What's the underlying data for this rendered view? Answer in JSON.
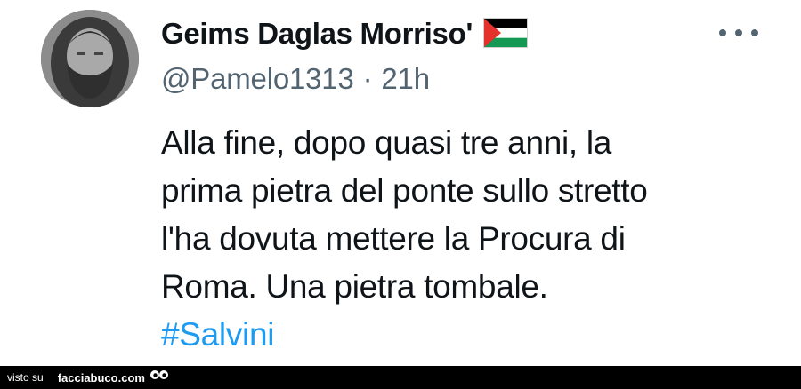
{
  "tweet": {
    "display_name": "Geims Daglas Morriso'",
    "flag_icon": "palestine-flag-icon",
    "handle": "@Pamelo1313",
    "separator": "·",
    "time": "21h",
    "body_lines": [
      "Alla fine, dopo quasi tre anni, la",
      "prima pietra del ponte sullo stretto",
      "l'ha dovuta mettere la Procura di",
      "Roma. Una pietra tombale."
    ],
    "hashtag": "#Salvini",
    "more_icon": "more-options-icon"
  },
  "footer": {
    "visto_su": "visto su",
    "site": "facciabuco.com",
    "logo_icon": "facciabuco-eyes-icon"
  },
  "colors": {
    "text": "#0f1419",
    "secondary": "#536471",
    "hashtag": "#1d9bf0",
    "footer_bg": "#000000"
  }
}
